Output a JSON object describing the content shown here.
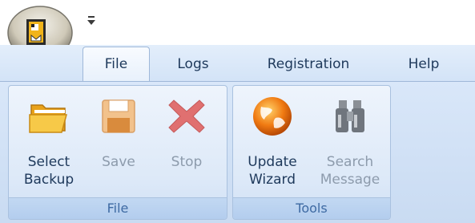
{
  "tabs": [
    {
      "label": "File"
    },
    {
      "label": "Logs"
    },
    {
      "label": "Registration"
    },
    {
      "label": "Help"
    }
  ],
  "groups": {
    "file": {
      "label": "File",
      "buttons": {
        "select_backup": {
          "line1": "Select",
          "line2": "Backup",
          "icon": "folder-open-icon"
        },
        "save": {
          "line1": "Save",
          "icon": "floppy-disk-icon",
          "enabled": false
        },
        "stop": {
          "line1": "Stop",
          "icon": "red-x-icon",
          "enabled": false
        }
      }
    },
    "tools": {
      "label": "Tools",
      "buttons": {
        "update_wizard": {
          "line1": "Update",
          "line2": "Wizard",
          "icon": "globe-icon"
        },
        "search_message": {
          "line1": "Search",
          "line2": "Message",
          "icon": "binoculars-icon",
          "enabled": false
        }
      }
    }
  },
  "colors": {
    "ribbon": "#d3e3f7",
    "group_label_text": "#3e6aa3",
    "text": "#1e395b",
    "disabled_text": "#8d9bac"
  }
}
